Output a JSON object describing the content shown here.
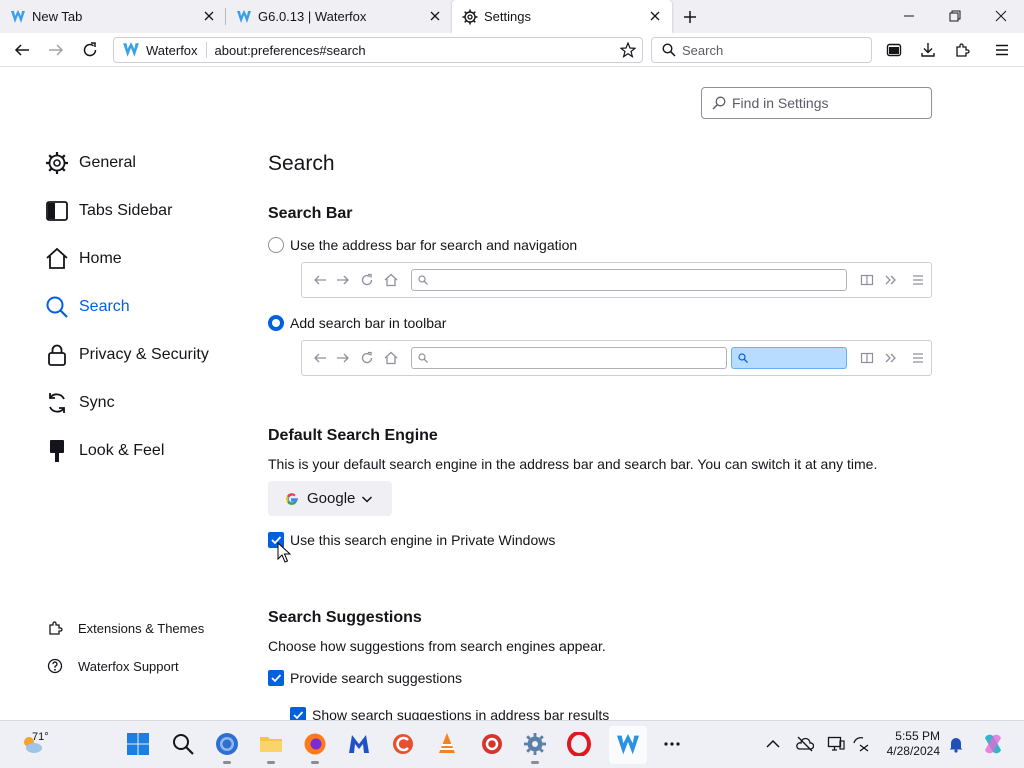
{
  "tabs": [
    {
      "title": "New Tab",
      "icon": "waterfox-icon",
      "active": false
    },
    {
      "title": "G6.0.13 | Waterfox",
      "icon": "waterfox-icon",
      "active": false
    },
    {
      "title": "Settings",
      "icon": "gear-icon",
      "active": true
    }
  ],
  "navbar": {
    "identity": "Waterfox",
    "url": "about:preferences#search",
    "search_placeholder": "Search"
  },
  "find": {
    "placeholder": "Find in Settings"
  },
  "sidebar": {
    "items": [
      {
        "label": "General",
        "icon": "gear-icon"
      },
      {
        "label": "Tabs Sidebar",
        "icon": "sidebar-icon"
      },
      {
        "label": "Home",
        "icon": "home-icon"
      },
      {
        "label": "Search",
        "icon": "search-icon",
        "selected": true
      },
      {
        "label": "Privacy & Security",
        "icon": "lock-icon"
      },
      {
        "label": "Sync",
        "icon": "sync-icon"
      },
      {
        "label": "Look & Feel",
        "icon": "brush-icon"
      }
    ],
    "footer": [
      {
        "label": "Extensions & Themes",
        "icon": "puzzle-icon"
      },
      {
        "label": "Waterfox Support",
        "icon": "help-icon"
      }
    ]
  },
  "main": {
    "title": "Search",
    "search_bar": {
      "heading": "Search Bar",
      "option_address": "Use the address bar for search and navigation",
      "option_toolbar": "Add search bar in toolbar",
      "selected": "toolbar"
    },
    "default_engine": {
      "heading": "Default Search Engine",
      "description": "This is your default search engine in the address bar and search bar. You can switch it at any time.",
      "engine": "Google",
      "private_label": "Use this search engine in Private Windows",
      "private_checked": true
    },
    "suggestions": {
      "heading": "Search Suggestions",
      "description": "Choose how suggestions from search engines appear.",
      "provide_label": "Provide search suggestions",
      "provide_checked": true,
      "address_label": "Show search suggestions in address bar results",
      "address_checked": true
    }
  },
  "taskbar": {
    "weather_temp": "71°",
    "time": "5:55 PM",
    "date": "4/28/2024"
  },
  "colors": {
    "accent": "#0061e0",
    "tab_strip": "#f0f0f4",
    "preview_search_fill": "#b8dcff"
  }
}
